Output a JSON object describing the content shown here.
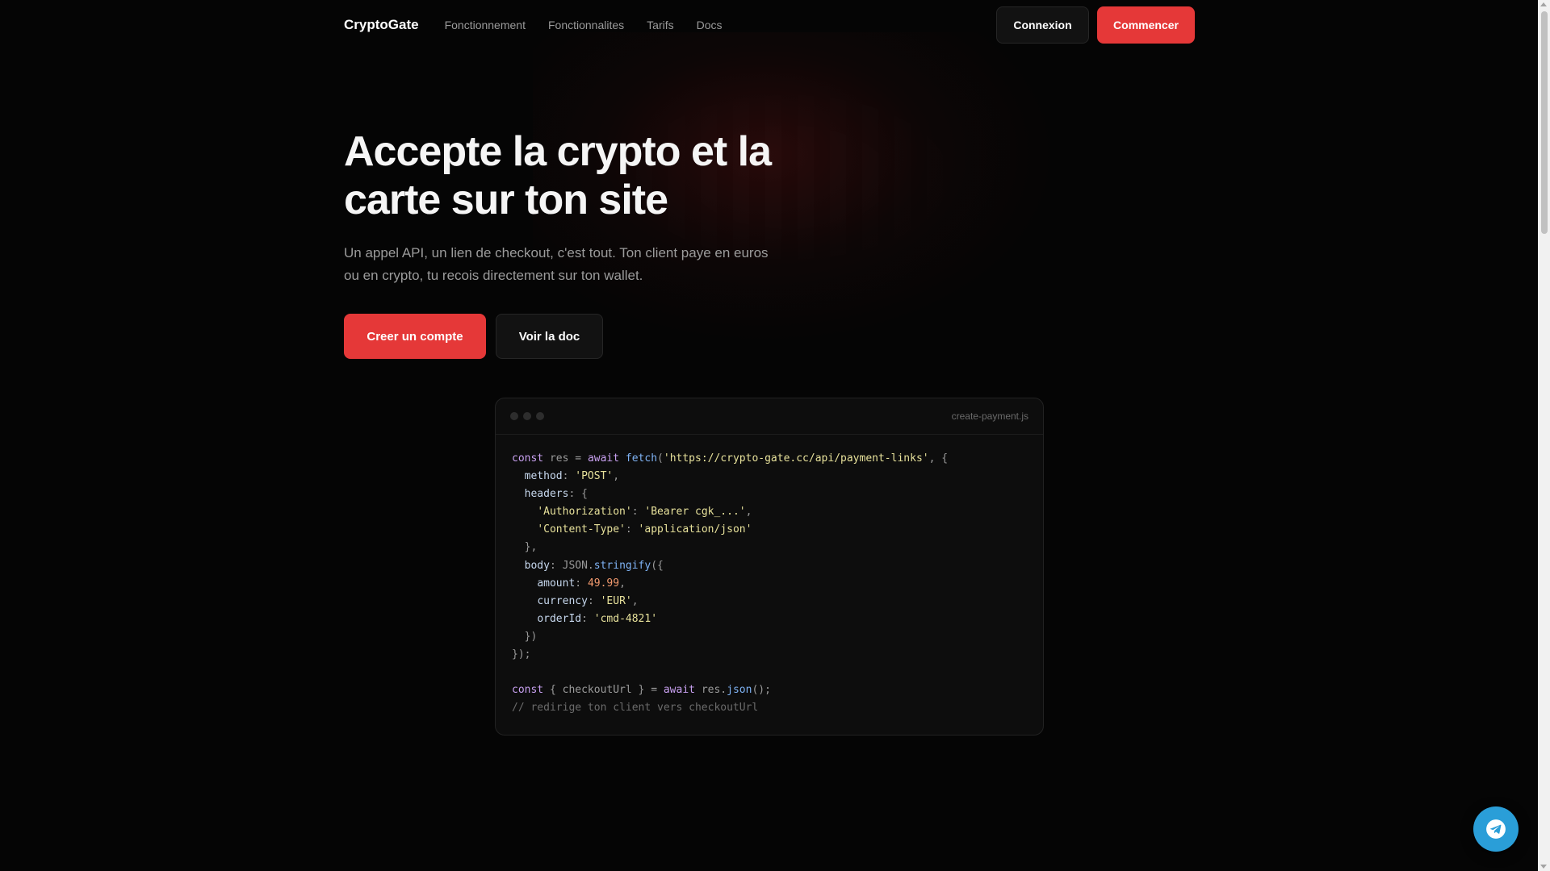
{
  "header": {
    "brand": "CryptoGate",
    "links": [
      "Fonctionnement",
      "Fonctionnalites",
      "Tarifs",
      "Docs"
    ],
    "login_label": "Connexion",
    "start_label": "Commencer"
  },
  "hero": {
    "title_line1": "Accepte la crypto et la",
    "title_line2": "carte sur ton site",
    "subtitle_line1": "Un appel API, un lien de checkout, c'est tout. Ton client paye en euros",
    "subtitle_line2": "ou en crypto, tu recois directement sur ton wallet.",
    "cta_primary": "Creer un compte",
    "cta_secondary": "Voir la doc"
  },
  "code_window": {
    "filename": "create-payment.js",
    "lines": [
      [
        [
          "k",
          "const"
        ],
        [
          "d",
          " res "
        ],
        [
          "d",
          "= "
        ],
        [
          "k",
          "await "
        ],
        [
          "f",
          "fetch"
        ],
        [
          "d",
          "("
        ],
        [
          "s",
          "'https://crypto-gate.cc/api/payment-links'"
        ],
        [
          "d",
          ", {"
        ]
      ],
      [
        [
          "d",
          "  "
        ],
        [
          "p",
          "method"
        ],
        [
          "d",
          ": "
        ],
        [
          "s",
          "'POST'"
        ],
        [
          "d",
          ","
        ]
      ],
      [
        [
          "d",
          "  "
        ],
        [
          "p",
          "headers"
        ],
        [
          "d",
          ": {"
        ]
      ],
      [
        [
          "d",
          "    "
        ],
        [
          "s",
          "'Authorization'"
        ],
        [
          "d",
          ": "
        ],
        [
          "s",
          "'Bearer cgk_...'"
        ],
        [
          "d",
          ","
        ]
      ],
      [
        [
          "d",
          "    "
        ],
        [
          "s",
          "'Content-Type'"
        ],
        [
          "d",
          ": "
        ],
        [
          "s",
          "'application/json'"
        ]
      ],
      [
        [
          "d",
          "  },"
        ]
      ],
      [
        [
          "d",
          "  "
        ],
        [
          "p",
          "body"
        ],
        [
          "d",
          ": JSON."
        ],
        [
          "f",
          "stringify"
        ],
        [
          "d",
          "({"
        ]
      ],
      [
        [
          "d",
          "    "
        ],
        [
          "p",
          "amount"
        ],
        [
          "d",
          ": "
        ],
        [
          "n",
          "49.99"
        ],
        [
          "d",
          ","
        ]
      ],
      [
        [
          "d",
          "    "
        ],
        [
          "p",
          "currency"
        ],
        [
          "d",
          ": "
        ],
        [
          "s",
          "'EUR'"
        ],
        [
          "d",
          ","
        ]
      ],
      [
        [
          "d",
          "    "
        ],
        [
          "p",
          "orderId"
        ],
        [
          "d",
          ": "
        ],
        [
          "s",
          "'cmd-4821'"
        ]
      ],
      [
        [
          "d",
          "  })"
        ]
      ],
      [
        [
          "d",
          "});"
        ]
      ],
      [
        [
          "d",
          ""
        ]
      ],
      [
        [
          "k",
          "const"
        ],
        [
          "d",
          " { checkoutUrl } = "
        ],
        [
          "k",
          "await "
        ],
        [
          "d",
          "res."
        ],
        [
          "f",
          "json"
        ],
        [
          "d",
          "();"
        ]
      ],
      [
        [
          "c",
          "// redirige ton client vers checkoutUrl"
        ]
      ]
    ]
  },
  "floating": {
    "icon": "telegram-icon"
  },
  "colors": {
    "accent": "#e53838",
    "background": "#050505",
    "telegram": "#2a9ed8"
  }
}
